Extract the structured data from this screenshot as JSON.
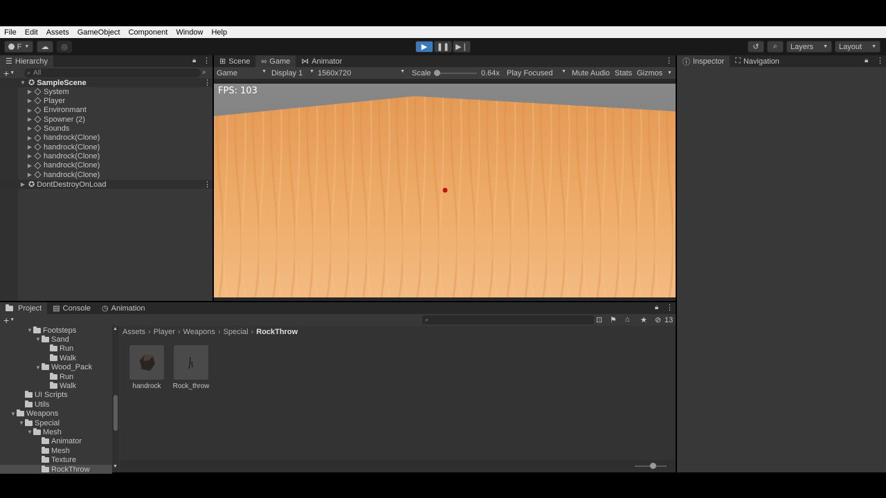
{
  "menu": [
    "File",
    "Edit",
    "Assets",
    "GameObject",
    "Component",
    "Window",
    "Help"
  ],
  "toolbar": {
    "account": "F",
    "layers": "Layers",
    "layout": "Layout"
  },
  "hierarchy": {
    "tab": "Hierarchy",
    "search_placeholder": "All",
    "scene": "SampleScene",
    "items": [
      "System",
      "Player",
      "Environmant",
      "Spowner (2)",
      "Sounds",
      "handrock(Clone)",
      "handrock(Clone)",
      "handrock(Clone)",
      "handrock(Clone)",
      "handrock(Clone)"
    ],
    "dont_destroy": "DontDestroyOnLoad"
  },
  "center_tabs": [
    "Scene",
    "Game",
    "Animator"
  ],
  "game_bar": {
    "mode": "Game",
    "display": "Display 1",
    "resolution": "1560x720",
    "scale_label": "Scale",
    "scale_value": "0.64x",
    "play_focused": "Play Focused",
    "mute": "Mute Audio",
    "stats": "Stats",
    "gizmos": "Gizmos"
  },
  "fps_text": "FPS:  103",
  "inspector_tabs": [
    "Inspector",
    "Navigation"
  ],
  "project": {
    "tabs": [
      "Project",
      "Console",
      "Animation"
    ],
    "hidden_count": "13",
    "breadcrumb": [
      "Assets",
      "Player",
      "Weapons",
      "Special",
      "RockThrow"
    ],
    "tree": [
      {
        "label": "Footsteps",
        "indent": 3,
        "open": true
      },
      {
        "label": "Sand",
        "indent": 4,
        "open": true
      },
      {
        "label": "Run",
        "indent": 5,
        "open": false
      },
      {
        "label": "Walk",
        "indent": 5,
        "open": false
      },
      {
        "label": "Wood_Pack",
        "indent": 4,
        "open": true
      },
      {
        "label": "Run",
        "indent": 5,
        "open": false
      },
      {
        "label": "Walk",
        "indent": 5,
        "open": false
      },
      {
        "label": "UI Scripts",
        "indent": 2,
        "open": false
      },
      {
        "label": "Utils",
        "indent": 2,
        "open": false
      },
      {
        "label": "Weapons",
        "indent": 1,
        "open": true
      },
      {
        "label": "Special",
        "indent": 2,
        "open": true
      },
      {
        "label": "Mesh",
        "indent": 3,
        "open": true
      },
      {
        "label": "Animator",
        "indent": 4,
        "open": false
      },
      {
        "label": "Mesh",
        "indent": 4,
        "open": false
      },
      {
        "label": "Texture",
        "indent": 4,
        "open": false
      },
      {
        "label": "RockThrow",
        "indent": 4,
        "open": false,
        "selected": true
      }
    ],
    "assets": [
      "handrock",
      "Rock_throw"
    ]
  },
  "colors": {
    "accent": "#3a79bb",
    "sand_light": "#f0b67a",
    "sand_dark": "#e39a55",
    "sky": "#7a7a7a"
  }
}
